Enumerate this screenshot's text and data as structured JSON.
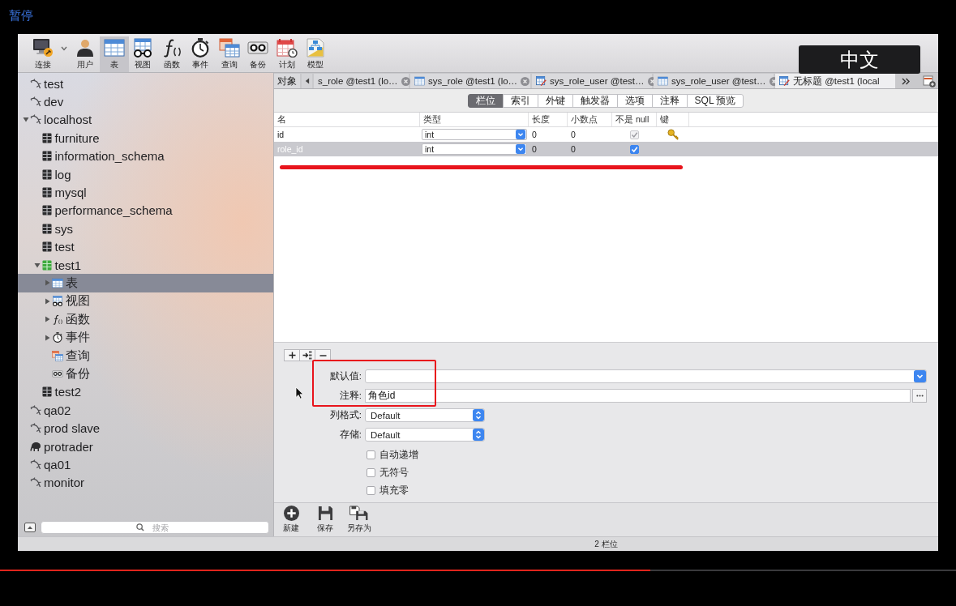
{
  "player": {
    "pause_label": "暂停",
    "progress": {
      "level": 0.68
    }
  },
  "toolbar": {
    "items": [
      {
        "label": "连接",
        "kind": "connect",
        "dropdown": true,
        "selected": false
      },
      {
        "label": "用户",
        "kind": "user",
        "selected": false
      },
      {
        "label": "表",
        "kind": "table",
        "selected": true
      },
      {
        "label": "视图",
        "kind": "view",
        "selected": false
      },
      {
        "label": "函数",
        "kind": "function",
        "selected": false
      },
      {
        "label": "事件",
        "kind": "event",
        "selected": false
      },
      {
        "label": "查询",
        "kind": "query",
        "selected": false
      },
      {
        "label": "备份",
        "kind": "backup",
        "selected": false
      },
      {
        "label": "计划",
        "kind": "schedule",
        "selected": false
      },
      {
        "label": "模型",
        "kind": "model",
        "selected": false
      }
    ]
  },
  "input_method_popup": {
    "label": "中文"
  },
  "sidebar": {
    "tree": [
      {
        "label": "test",
        "kind": "connection",
        "selected": false
      },
      {
        "label": "dev",
        "kind": "connection",
        "selected": false
      },
      {
        "label": "localhost",
        "kind": "connection",
        "selected": false,
        "expanded": true,
        "children": [
          {
            "label": "furniture",
            "kind": "database",
            "open": false,
            "selected": false
          },
          {
            "label": "information_schema",
            "kind": "database",
            "open": false,
            "selected": false
          },
          {
            "label": "log",
            "kind": "database",
            "open": false,
            "selected": false
          },
          {
            "label": "mysql",
            "kind": "database",
            "open": false,
            "selected": false
          },
          {
            "label": "performance_schema",
            "kind": "database",
            "open": false,
            "selected": false
          },
          {
            "label": "sys",
            "kind": "database",
            "open": false,
            "selected": false
          },
          {
            "label": "test",
            "kind": "database",
            "open": false,
            "selected": false
          },
          {
            "label": "test1",
            "kind": "database",
            "open": true,
            "selected": false,
            "expanded": true,
            "children": [
              {
                "label": "表",
                "kind": "tables",
                "selected": true,
                "expanded": false
              },
              {
                "label": "视图",
                "kind": "views",
                "selected": false,
                "expanded": false
              },
              {
                "label": "函数",
                "kind": "functions",
                "selected": false,
                "expanded": false
              },
              {
                "label": "事件",
                "kind": "events",
                "selected": false,
                "expanded": false
              },
              {
                "label": "查询",
                "kind": "queries",
                "selected": false
              },
              {
                "label": "备份",
                "kind": "backups",
                "selected": false
              }
            ]
          },
          {
            "label": "test2",
            "kind": "database",
            "open": false,
            "selected": false
          }
        ]
      },
      {
        "label": "qa02",
        "kind": "connection",
        "selected": false
      },
      {
        "label": "prod slave",
        "kind": "connection",
        "selected": false
      },
      {
        "label": "protrader",
        "kind": "server",
        "selected": false
      },
      {
        "label": "qa01",
        "kind": "connection",
        "selected": false
      },
      {
        "label": "monitor",
        "kind": "connection",
        "selected": false
      }
    ],
    "search": {
      "placeholder": "搜索"
    }
  },
  "tab_bar": {
    "objects_tab": {
      "label": "对象",
      "selected": false
    },
    "tabs": [
      {
        "label": "s_role @test1 (lo…",
        "kind": "partial",
        "closable": true,
        "selected": false
      },
      {
        "label": "sys_role @test1 (lo…",
        "kind": "table",
        "closable": true,
        "selected": false
      },
      {
        "label": "sys_role_user @test…",
        "kind": "design",
        "closable": true,
        "selected": false
      },
      {
        "label": "sys_role_user @test…",
        "kind": "table",
        "closable": true,
        "selected": false
      },
      {
        "label": "无标题 @test1 (local",
        "kind": "design",
        "closable": false,
        "selected": true
      }
    ]
  },
  "field_tabs": [
    {
      "label": "栏位",
      "selected": true
    },
    {
      "label": "索引",
      "selected": false
    },
    {
      "label": "外键",
      "selected": false
    },
    {
      "label": "触发器",
      "selected": false
    },
    {
      "label": "选项",
      "selected": false
    },
    {
      "label": "注释",
      "selected": false
    },
    {
      "label": "SQL 预览",
      "selected": false
    }
  ],
  "columns_table": {
    "columns": [
      "名",
      "类型",
      "长度",
      "小数点",
      "不是 null",
      "键"
    ],
    "rows": [
      {
        "name": "id",
        "type": "int",
        "length": "0",
        "decimals": "0",
        "not_null": {
          "checked": true,
          "disabled": true
        },
        "primary_key": true,
        "selected": false
      },
      {
        "name": "role_id",
        "type": "int",
        "length": "0",
        "decimals": "0",
        "not_null": {
          "checked": true,
          "disabled": false
        },
        "primary_key": false,
        "selected": true
      }
    ]
  },
  "properties": {
    "fields": [
      {
        "label": "默认值:",
        "kind": "combo"
      },
      {
        "label": "注释:",
        "kind": "text",
        "value": "角色id"
      },
      {
        "label": "列格式:",
        "kind": "popup",
        "value": "Default"
      },
      {
        "label": "存储:",
        "kind": "popup",
        "value": "Default"
      }
    ],
    "options": [
      {
        "label": "自动递增",
        "checked": false
      },
      {
        "label": "无符号",
        "checked": false
      },
      {
        "label": "填充零",
        "checked": false
      }
    ]
  },
  "actions": [
    {
      "label": "新建",
      "kind": "new"
    },
    {
      "label": "保存",
      "kind": "save"
    },
    {
      "label": "另存为",
      "kind": "save_as"
    }
  ],
  "status_bar": {
    "text": "2 栏位"
  },
  "annotations": {
    "underline": true,
    "frame": true
  }
}
